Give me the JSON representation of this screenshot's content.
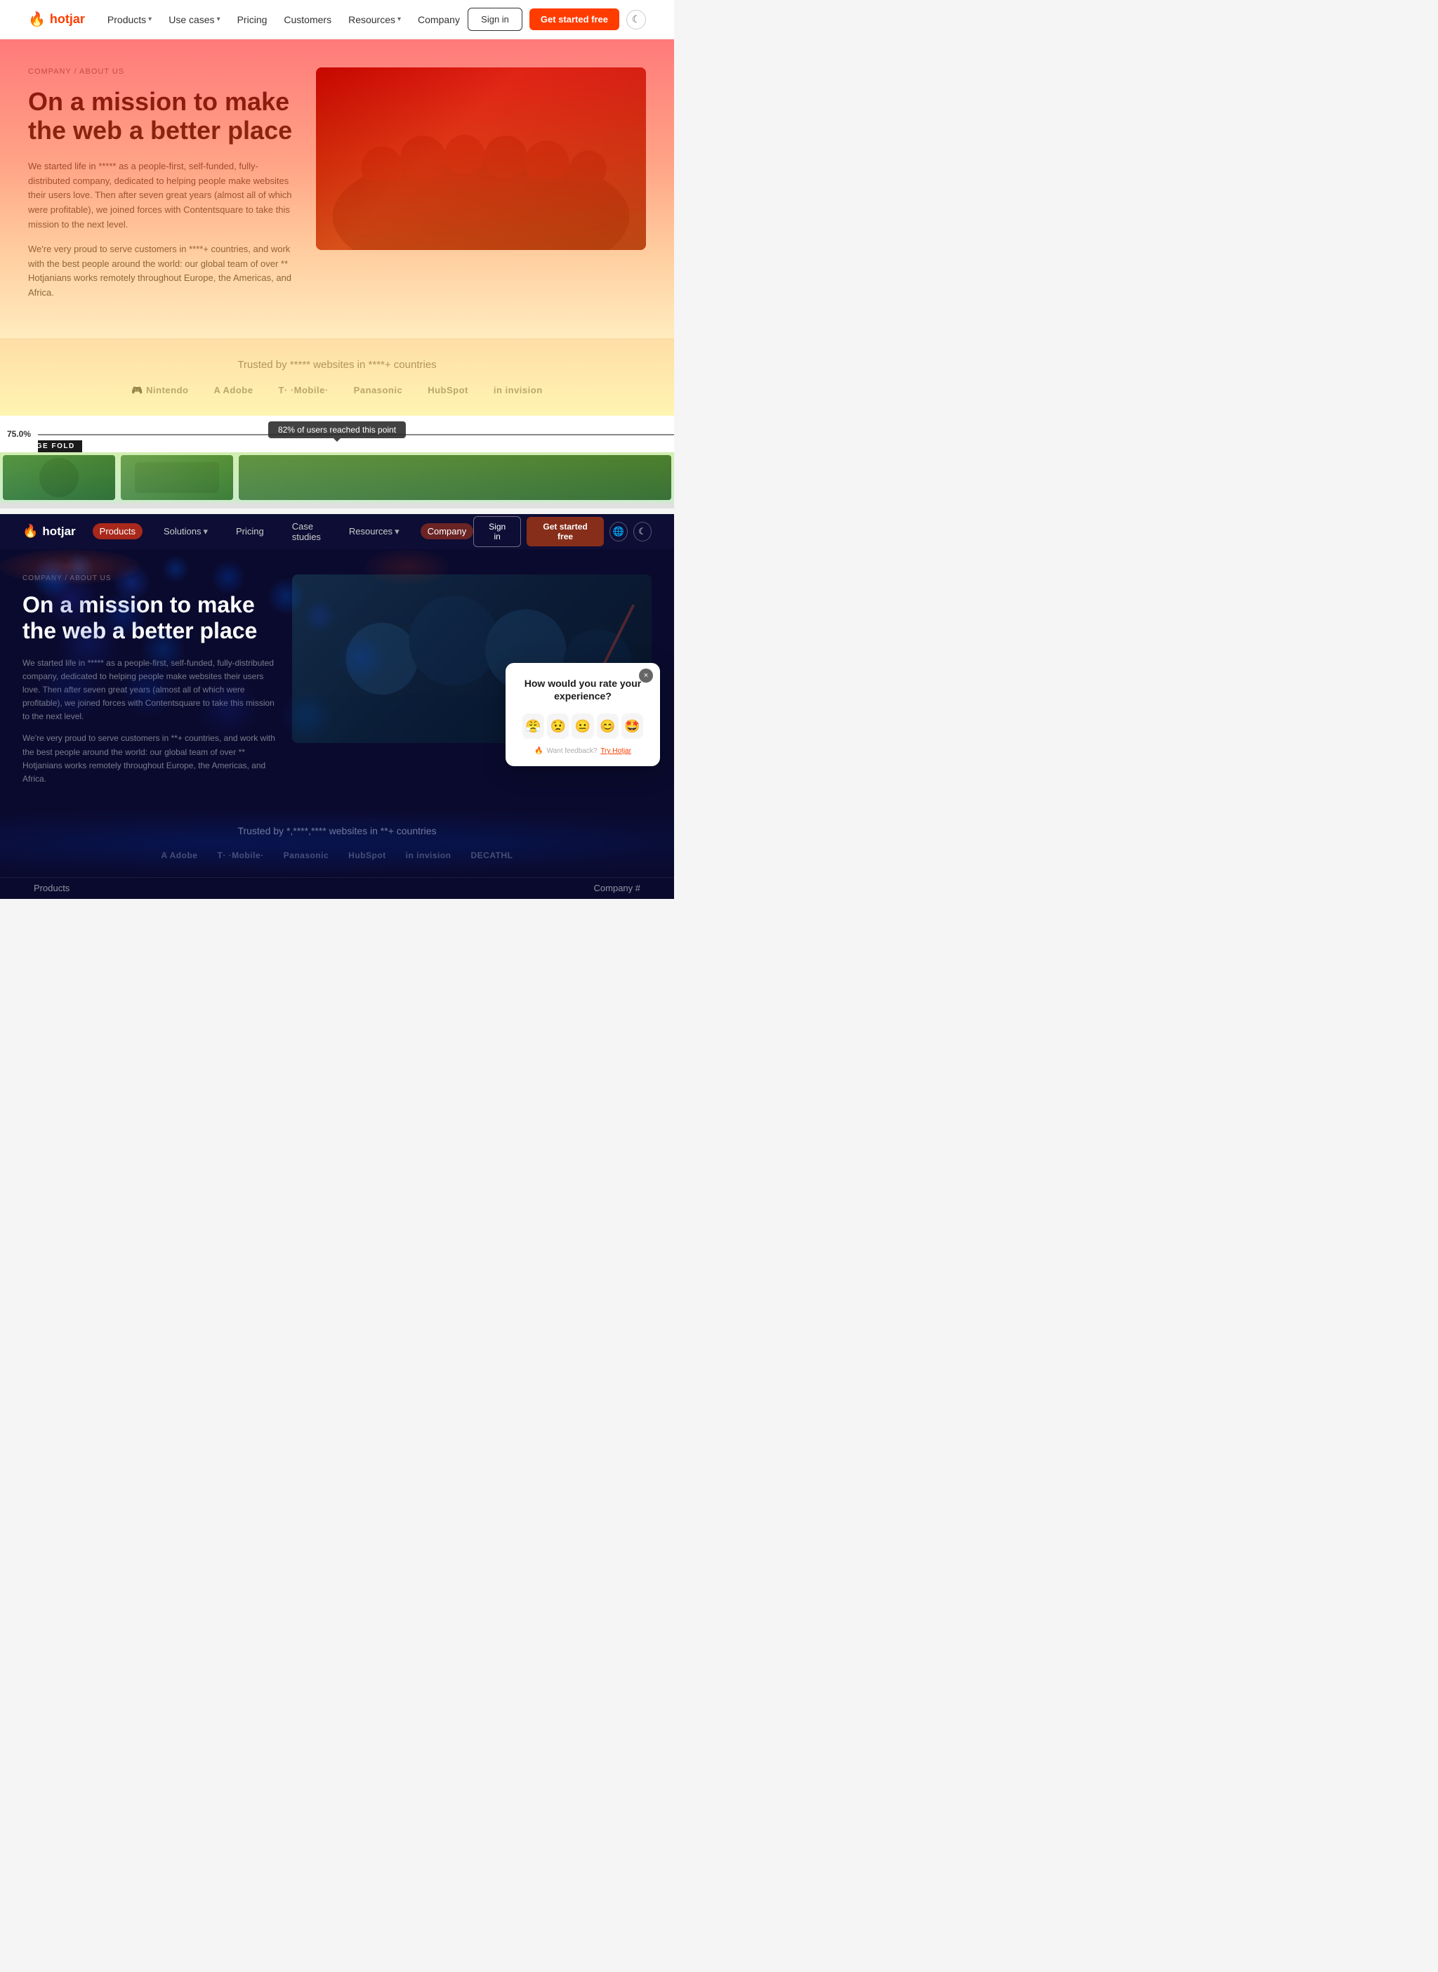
{
  "top": {
    "nav": {
      "logo": "hotjar",
      "logo_icon": "🔥",
      "links": [
        {
          "label": "Products",
          "has_chevron": true
        },
        {
          "label": "Use cases",
          "has_chevron": true
        },
        {
          "label": "Pricing",
          "has_chevron": false
        },
        {
          "label": "Customers",
          "has_chevron": false
        },
        {
          "label": "Resources",
          "has_chevron": true
        },
        {
          "label": "Company",
          "has_chevron": false
        }
      ],
      "signin_label": "Sign in",
      "getstarted_label": "Get started free",
      "moon_icon": "☾"
    },
    "hero": {
      "breadcrumb": "COMPANY / ABOUT US",
      "title": "On a mission to make the web a better place",
      "desc1": "We started life in ***** as a people-first, self-funded, fully-distributed company, dedicated to helping people make websites their users love. Then after seven great years (almost all of which were profitable), we joined forces with Contentsquare to take this mission to the next level.",
      "desc2": "We're very proud to serve customers in ****+ countries, and work with the best people around the world: our global team of over ** Hotjanians works remotely throughout Europe, the Americas, and Africa."
    },
    "trusted": {
      "text": "Trusted by ***** websites in ****+ countries",
      "logos": [
        "Nintendo",
        "Adobe",
        "T-Mobile",
        "Panasonic",
        "HubSpot",
        "invision"
      ]
    },
    "fold": {
      "percentage": "75.0%",
      "label": "AVERAGE FOLD",
      "reach_text": "82% of users reached this point"
    }
  },
  "bottom": {
    "nav": {
      "logo": "hotjar",
      "logo_icon": "🔥",
      "links": [
        {
          "label": "Products",
          "active": true
        },
        {
          "label": "Solutions",
          "has_chevron": true,
          "active": false
        },
        {
          "label": "Pricing",
          "active": false
        },
        {
          "label": "Case studies",
          "active": false
        },
        {
          "label": "Resources",
          "has_chevron": true,
          "active": false
        },
        {
          "label": "Company",
          "active": true
        }
      ],
      "signin_label": "Sign in",
      "getstarted_label": "Get started free",
      "globe_icon": "🌐",
      "moon_icon": "☾"
    },
    "hero": {
      "breadcrumb": "COMPANY / ABOUT US",
      "title": "On a mission to make the web a better place",
      "desc1": "We started life in ***** as a people-first, self-funded, fully-distributed company, dedicated to helping people make websites their users love. Then after seven great years (almost all of which were profitable), we joined forces with Contentsquare to take this mission to the next level.",
      "desc2": "We're very proud to serve customers in **+ countries, and work with the best people around the world: our global team of over ** Hotjanians works remotely throughout Europe, the Americas, and Africa."
    },
    "feedback": {
      "question": "How would you rate your experience?",
      "emojis": [
        "😤",
        "😟",
        "😐",
        "😊",
        "🤩"
      ],
      "footer_text": "Want feedback?",
      "footer_link": "Try Hotjar",
      "close_icon": "×"
    },
    "trusted": {
      "text": "Trusted by *,****,**** websites in **+ countries",
      "logos": [
        "Adobe",
        "T-Mobile",
        "Panasonic",
        "HubSpot",
        "invision",
        "DECATHL"
      ]
    },
    "data_labels": {
      "company_hash": "Company #",
      "products": "Products"
    }
  }
}
